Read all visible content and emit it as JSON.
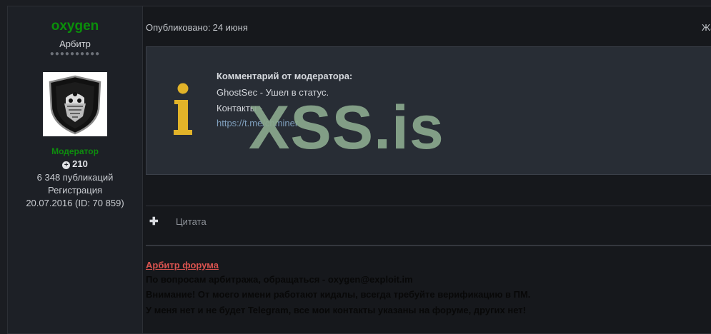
{
  "author": {
    "username": "oxygen",
    "title": "Арбитр",
    "pips": "●●●●●●●●●●",
    "role": "Модератор",
    "reputation": "210",
    "posts": "6 348 публикаций",
    "registration_label": "Регистрация",
    "registration_value": "20.07.2016 (ID: 70 859)"
  },
  "post": {
    "published_label": "Опубликовано:",
    "published_date": "24 июня",
    "report_label": "Жал"
  },
  "moderator_note": {
    "title": "Комментарий от модератора:",
    "line1": "GhostSec - Ушел в статус.",
    "line2": "Контакты -",
    "link": "https://t.me/chminer"
  },
  "watermark": "XSS.is",
  "quote": {
    "plus": "✚",
    "label": "Цитата"
  },
  "signature": {
    "heading": "Арбитр форума",
    "line1": "По вопросам арбитража, обращаться - oxygen@exploit.im",
    "line2": "Внимание! От моего имени работают кидалы, всегда требуйте верификацию в ПМ.",
    "line3": "У меня нет и не будет Telegram, все мои контакты указаны на форуме, других нет!"
  },
  "colors": {
    "username": "#0a8f0a",
    "role": "#0e8c0e",
    "info_icon": "#e2b329",
    "sig_heading": "#d9534f",
    "link": "#7f9fbd"
  }
}
